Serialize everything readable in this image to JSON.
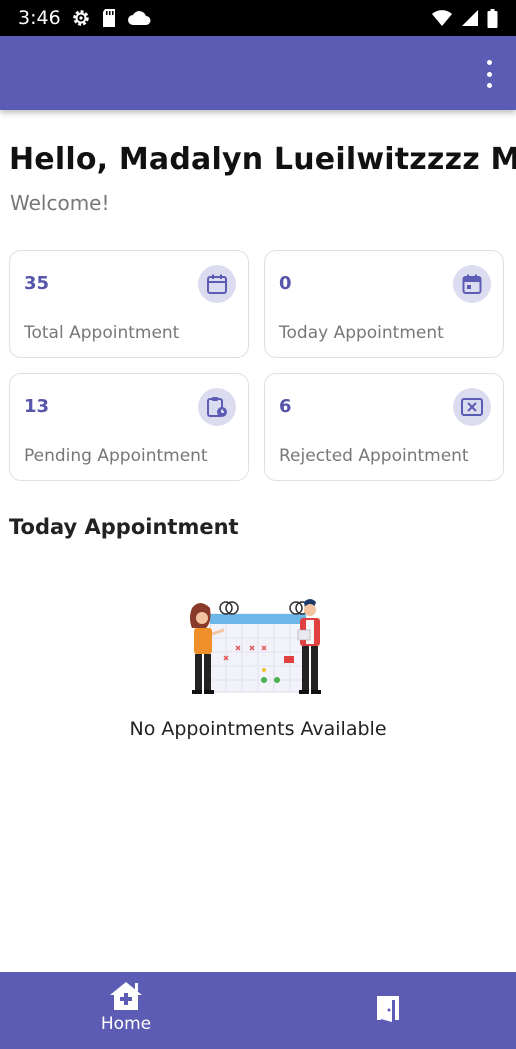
{
  "status_bar": {
    "time": "3:46",
    "icons_left": [
      "settings-gear-icon",
      "sd-card-icon",
      "cloud-icon"
    ],
    "icons_right": [
      "wifi-icon",
      "signal-icon",
      "battery-icon"
    ]
  },
  "app_bar": {
    "menu_icon": "more-vert-icon",
    "color": "#5c5cb5"
  },
  "greeting": {
    "title": "Hello, Madalyn Lueilwitzzzz MD",
    "subtitle": "Welcome!"
  },
  "stats": [
    {
      "value": "35",
      "label": "Total Appointment",
      "icon": "calendar-icon"
    },
    {
      "value": "0",
      "label": "Today Appointment",
      "icon": "calendar-today-icon"
    },
    {
      "value": "13",
      "label": "Pending Appointment",
      "icon": "pending-clipboard-icon"
    },
    {
      "value": "6",
      "label": "Rejected Appointment",
      "icon": "rejected-x-icon"
    }
  ],
  "today_section": {
    "title": "Today Appointment",
    "empty_text": "No Appointments Available"
  },
  "bottom_nav": {
    "items": [
      {
        "label": "Home",
        "icon": "home-plus-icon"
      },
      {
        "label": "",
        "icon": "logout-door-icon"
      }
    ]
  },
  "colors": {
    "primary": "#5c5cb5",
    "accent_text": "#5555aa",
    "icon_bg": "#dcdcf0"
  }
}
